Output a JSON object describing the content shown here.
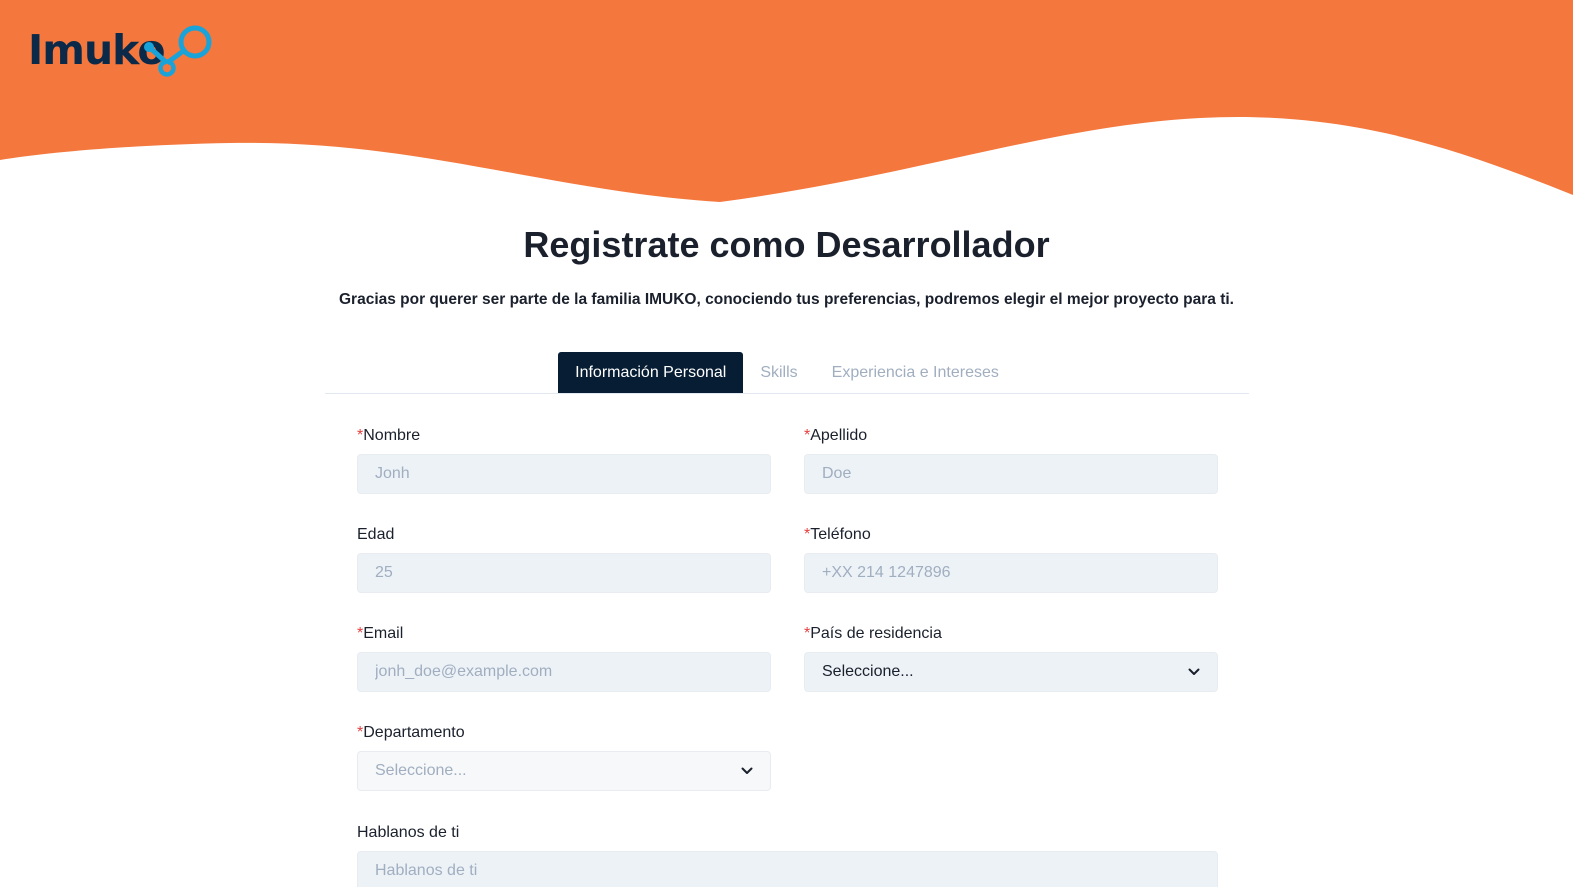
{
  "brand": {
    "logo_text": "Imuko",
    "accent": "#f4773d",
    "logo_color": "#0b2a4a",
    "logo_mark_color": "#1aa3d8"
  },
  "title": "Registrate como Desarrollador",
  "subtitle": "Gracias por querer ser parte de la familia IMUKO, conociendo tus preferencias, podremos elegir el mejor proyecto para ti.",
  "tabs": [
    {
      "label": "Información Personal",
      "active": true
    },
    {
      "label": "Skills",
      "active": false
    },
    {
      "label": "Experiencia e Intereses",
      "active": false
    }
  ],
  "form": {
    "required_mark": "*",
    "nombre": {
      "label": "Nombre",
      "placeholder": "Jonh",
      "value": ""
    },
    "apellido": {
      "label": "Apellido",
      "placeholder": "Doe",
      "value": ""
    },
    "edad": {
      "label": "Edad",
      "placeholder": "25",
      "value": ""
    },
    "telefono": {
      "label": "Teléfono",
      "placeholder": "+XX 214 1247896",
      "value": ""
    },
    "email": {
      "label": "Email",
      "placeholder": "jonh_doe@example.com",
      "value": ""
    },
    "pais": {
      "label": "País de residencia",
      "selected": "Seleccione..."
    },
    "departamento": {
      "label": "Departamento",
      "selected": "Seleccione..."
    },
    "hablanos": {
      "label": "Hablanos de ti",
      "placeholder": "Hablanos de ti",
      "value": ""
    }
  }
}
